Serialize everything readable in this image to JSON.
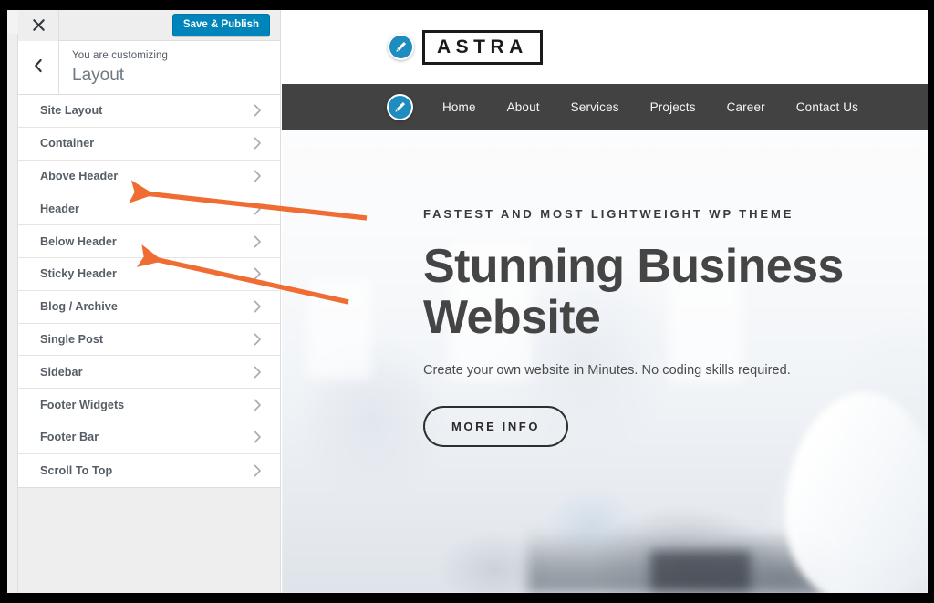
{
  "customizer": {
    "close_label": "×",
    "close_icon": "close-icon",
    "save_button_label": "Save & Publish",
    "back_icon": "chevron-left-icon",
    "eyebrow": "You are customizing",
    "panel_title": "Layout",
    "accent_color": "#0085ba",
    "sections": [
      {
        "label": "Site Layout"
      },
      {
        "label": "Container"
      },
      {
        "label": "Above Header"
      },
      {
        "label": "Header"
      },
      {
        "label": "Below Header"
      },
      {
        "label": "Sticky Header"
      },
      {
        "label": "Blog / Archive"
      },
      {
        "label": "Single Post"
      },
      {
        "label": "Sidebar"
      },
      {
        "label": "Footer Widgets"
      },
      {
        "label": "Footer Bar"
      },
      {
        "label": "Scroll To Top"
      }
    ]
  },
  "preview": {
    "logo_text": "ASTRA",
    "edit_icon": "pencil-edit-icon",
    "nav_edit_icon": "pencil-edit-icon",
    "nav_items": [
      {
        "label": "Home"
      },
      {
        "label": "About"
      },
      {
        "label": "Services"
      },
      {
        "label": "Projects"
      },
      {
        "label": "Career"
      },
      {
        "label": "Contact Us"
      }
    ],
    "hero": {
      "eyebrow": "FASTEST AND MOST LIGHTWEIGHT WP THEME",
      "title_line1": "Stunning Business",
      "title_line2": "Website",
      "subtitle": "Create your own website in Minutes. No coding skills required.",
      "cta_label": "MORE INFO"
    },
    "nav_bar_color": "#424242"
  },
  "annotations": {
    "arrow_color": "#ef6c33",
    "arrows": [
      {
        "name": "arrow-to-above-header",
        "target": "Above Header"
      },
      {
        "name": "arrow-to-below-header",
        "target": "Below Header"
      }
    ]
  }
}
